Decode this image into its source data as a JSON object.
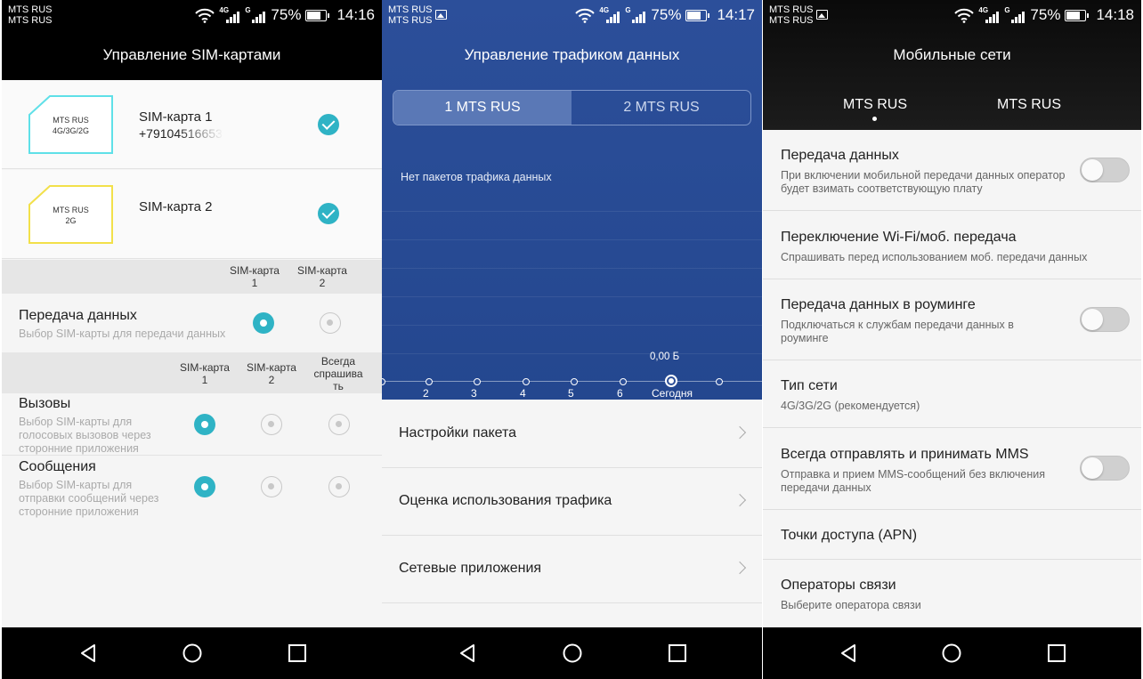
{
  "status_bars": [
    {
      "operators": [
        "MTS RUS",
        "MTS RUS"
      ],
      "battery": "75%",
      "time": "14:16",
      "show_gallery_icon": false
    },
    {
      "operators": [
        "MTS RUS",
        "MTS RUS"
      ],
      "battery": "75%",
      "time": "14:17",
      "show_gallery_icon": true
    },
    {
      "operators": [
        "MTS RUS",
        "MTS RUS"
      ],
      "battery": "75%",
      "time": "14:18",
      "show_gallery_icon": true
    }
  ],
  "signal_tags": [
    "4G",
    "G"
  ],
  "battery_level": 0.75,
  "sim_management": {
    "title": "Управление SIM-картами",
    "sims": [
      {
        "chip_operator": "MTS RUS",
        "chip_network": "4G/3G/2G",
        "name": "SIM-карта 1",
        "number": "+79104516653",
        "enabled": true,
        "color": "#5fe0e8"
      },
      {
        "chip_operator": "MTS RUS",
        "chip_network": "2G",
        "name": "SIM-карта 2",
        "number": "",
        "enabled": true,
        "color": "#f2e04a"
      }
    ],
    "data_header": {
      "sim1": "SIM-карта 1",
      "sim2": "SIM-карта 2"
    },
    "data_option": {
      "title": "Передача данных",
      "subtitle": "Выбор SIM-карты для передачи данных",
      "selected": "sim1"
    },
    "calls_header": {
      "sim1": "SIM-карта 1",
      "sim2": "SIM-карта 2",
      "ask": "Всегда спрашива ть"
    },
    "calls_option": {
      "title": "Вызовы",
      "subtitle": "Выбор SIM-карты для голосовых вызовов через сторонние приложения",
      "selected": "sim1"
    },
    "messages_option": {
      "title": "Сообщения",
      "subtitle": "Выбор SIM-карты для отправки сообщений через сторонние приложения",
      "selected": "sim1"
    },
    "accent": "#2fb3c5"
  },
  "traffic": {
    "title": "Управление трафиком данных",
    "tabs": [
      "1 MTS RUS",
      "2 MTS RUS"
    ],
    "active_tab": 0,
    "no_data": "Нет пакетов трафика данных",
    "chart_value": "0,00 Б",
    "axis_labels": [
      "2",
      "3",
      "4",
      "5",
      "6",
      "Сегодня"
    ],
    "menu": [
      "Настройки пакета",
      "Оценка использования трафика",
      "Сетевые приложения"
    ],
    "bg_color": "#2a4c97"
  },
  "mobile_networks": {
    "title": "Мобильные сети",
    "tabs": [
      "MTS RUS",
      "MTS RUS"
    ],
    "active_tab": 0,
    "settings": [
      {
        "title": "Передача данных",
        "subtitle": "При включении мобильной передачи данных оператор будет взимать соответствующую плату",
        "toggle": false
      },
      {
        "title": "Переключение Wi-Fi/моб. передача",
        "subtitle": "Спрашивать перед использованием моб. передачи данных"
      },
      {
        "title": "Передача данных в роуминге",
        "subtitle": "Подключаться к службам передачи данных в роуминге",
        "toggle": false
      },
      {
        "title": "Тип сети",
        "subtitle": "4G/3G/2G (рекомендуется)"
      },
      {
        "title": "Всегда отправлять и принимать MMS",
        "subtitle": "Отправка и прием MMS-сообщений без включения передачи данных",
        "toggle": false
      },
      {
        "title": "Точки доступа (APN)",
        "subtitle": ""
      },
      {
        "title": "Операторы связи",
        "subtitle": "Выберите оператора связи"
      }
    ]
  },
  "nav_icons": [
    "back-icon",
    "home-icon",
    "recents-icon"
  ]
}
